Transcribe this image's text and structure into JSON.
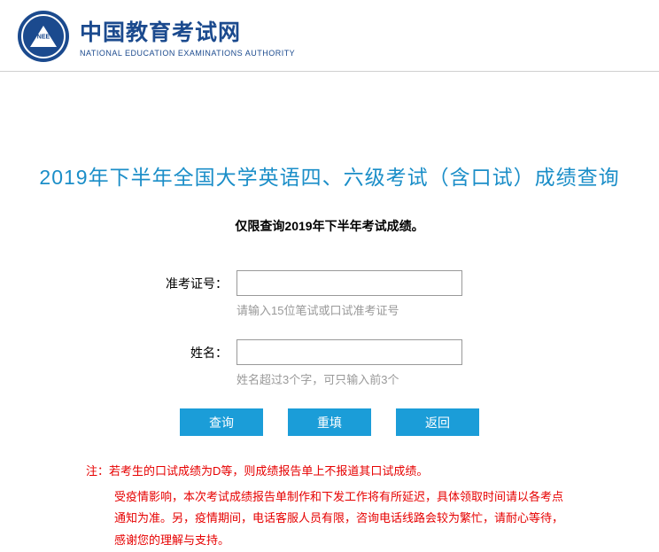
{
  "header": {
    "logo_abbr": "NEE",
    "cn_title": "中国教育考试网",
    "en_title": "NATIONAL EDUCATION EXAMINATIONS AUTHORITY"
  },
  "page_title": "2019年下半年全国大学英语四、六级考试（含口试）成绩查询",
  "subtitle": "仅限查询2019年下半年考试成绩。",
  "form": {
    "ticket_label": "准考证号：",
    "ticket_hint": "请输入15位笔试或口试准考证号",
    "name_label": "姓名：",
    "name_hint": "姓名超过3个字，可只输入前3个"
  },
  "buttons": {
    "query": "查询",
    "reset": "重填",
    "back": "返回"
  },
  "notes": {
    "line1": "注：若考生的口试成绩为D等，则成绩报告单上不报道其口试成绩。",
    "line2": "受疫情影响，本次考试成绩报告单制作和下发工作将有所延迟，具体领取时间请以各考点通知为准。另，疫情期间，电话客服人员有限，咨询电话线路会较为繁忙，请耐心等待，感谢您的理解与支持。"
  }
}
